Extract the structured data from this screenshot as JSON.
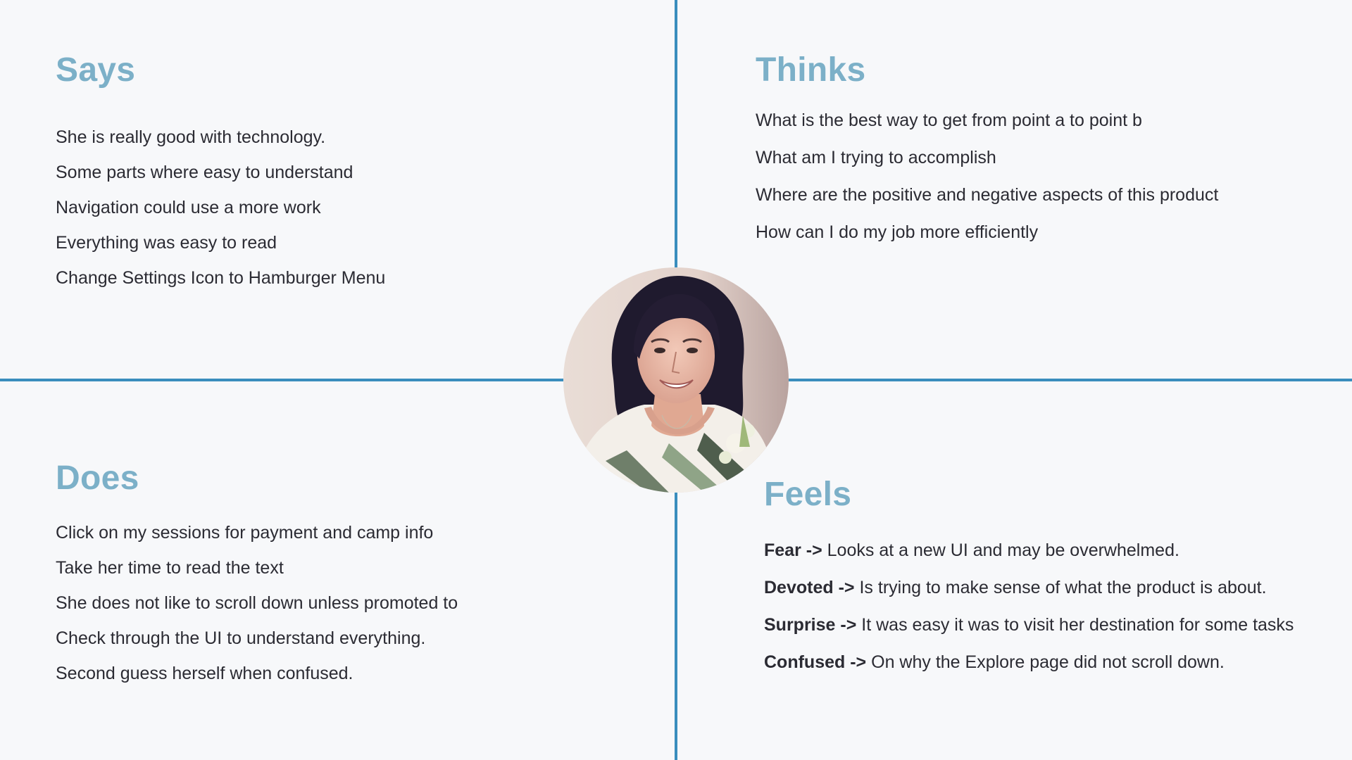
{
  "says": {
    "title": "Says",
    "items": [
      "She is really good with technology.",
      "Some parts where easy to understand",
      "Navigation could use a more work",
      "Everything was easy to read",
      "Change Settings Icon to Hamburger Menu"
    ]
  },
  "thinks": {
    "title": "Thinks",
    "items": [
      "What is the best way to get from point a to point b",
      "What am I trying to accomplish",
      "Where are the positive and negative aspects of this product",
      "How can I do my job more efficiently"
    ]
  },
  "does": {
    "title": "Does",
    "items": [
      "Click on my sessions for payment and camp info",
      "Take her time to read the text",
      "She does not like to scroll down unless promoted to",
      "Check through the UI to understand everything.",
      "Second guess herself when confused."
    ]
  },
  "feels": {
    "title": "Feels",
    "items": [
      {
        "label": "Fear",
        "arrow": "->",
        "text": "Looks at a new UI and may be overwhelmed."
      },
      {
        "label": "Devoted",
        "arrow": "->",
        "text": "Is trying to make sense of what the product is about."
      },
      {
        "label": "Surprise",
        "arrow": "->",
        "text": "It was easy it was to visit her destination for some tasks"
      },
      {
        "label": "Confused",
        "arrow": "->",
        "text": "On why the Explore page did not scroll down."
      }
    ]
  },
  "colors": {
    "accent_line": "#3a8dbd",
    "heading": "#7cb0c8",
    "text": "#2b2b33",
    "background": "#f7f8fa"
  },
  "portrait": {
    "icon": "persona-photo"
  }
}
